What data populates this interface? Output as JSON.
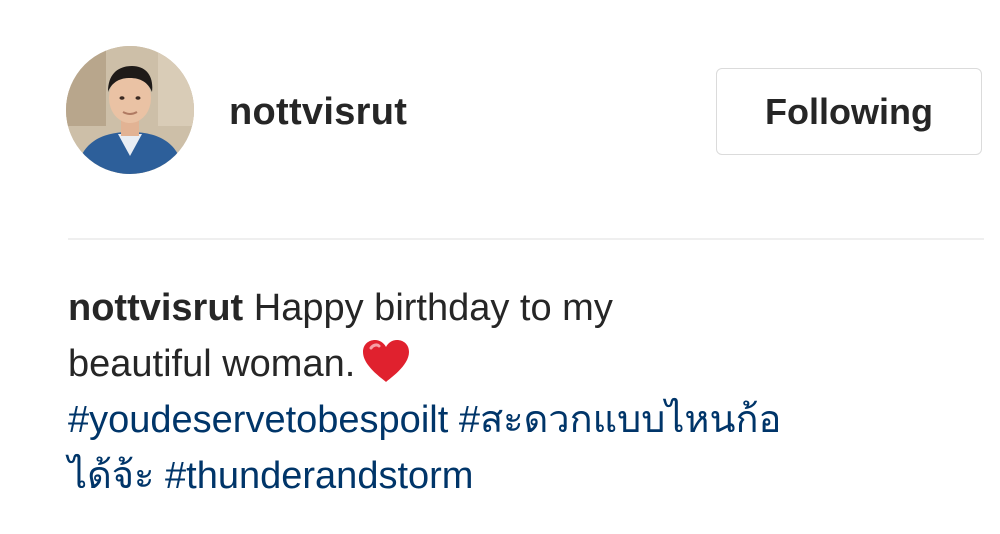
{
  "post": {
    "header": {
      "username": "nottvisrut",
      "follow_button_label": "Following"
    },
    "caption": {
      "username": "nottvisrut",
      "line1_text": "Happy birthday to my",
      "line2_text": "beautiful woman.",
      "emoji": "heart-icon",
      "hashtags": [
        "#youdeservetobespoilt",
        "#สะดวกแบบไหนก้อ",
        "ได้จ้ะ",
        "#thunderandstorm"
      ]
    },
    "colors": {
      "text": "#262626",
      "hashtag": "#003569",
      "border": "#dbdbdb",
      "divider": "#efefef",
      "heart": "#e0212e"
    }
  }
}
